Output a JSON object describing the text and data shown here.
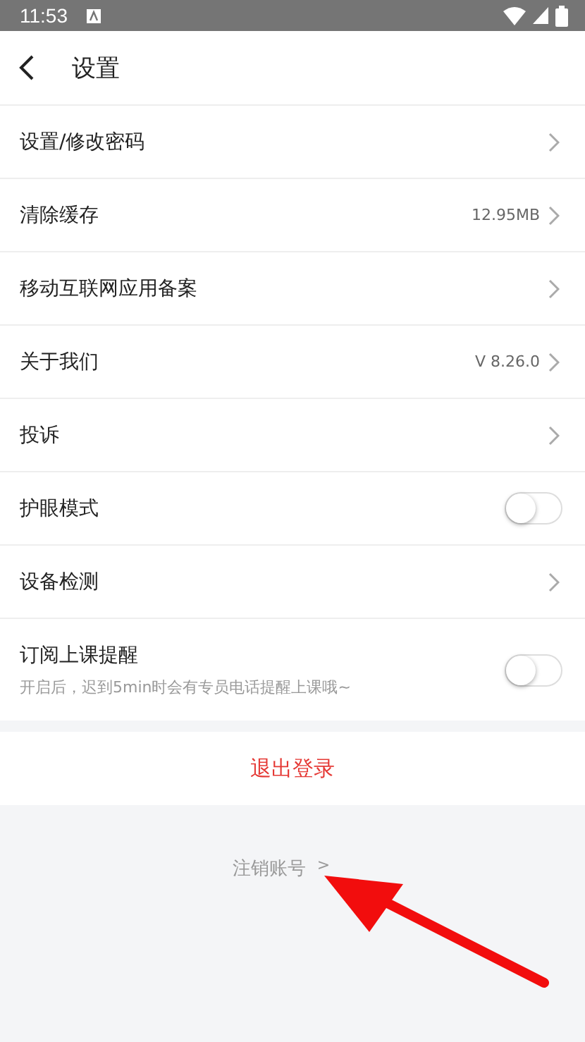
{
  "status_bar": {
    "time": "11:53"
  },
  "header": {
    "title": "设置"
  },
  "rows": [
    {
      "kind": "link",
      "label": "设置/修改密码"
    },
    {
      "kind": "link",
      "label": "清除缓存",
      "value": "12.95MB"
    },
    {
      "kind": "link",
      "label": "移动互联网应用备案"
    },
    {
      "kind": "link",
      "label": "关于我们",
      "value": "V 8.26.0"
    },
    {
      "kind": "link",
      "label": "投诉"
    },
    {
      "kind": "toggle",
      "label": "护眼模式",
      "on": false
    },
    {
      "kind": "link",
      "label": "设备检测"
    },
    {
      "kind": "toggle",
      "label": "订阅上课提醒",
      "hint": "开启后，迟到5min时会有专员电话提醒上课哦~",
      "on": false
    }
  ],
  "logout": {
    "label": "退出登录"
  },
  "deactivate": {
    "label": "注销账号",
    "arrow": ">"
  }
}
